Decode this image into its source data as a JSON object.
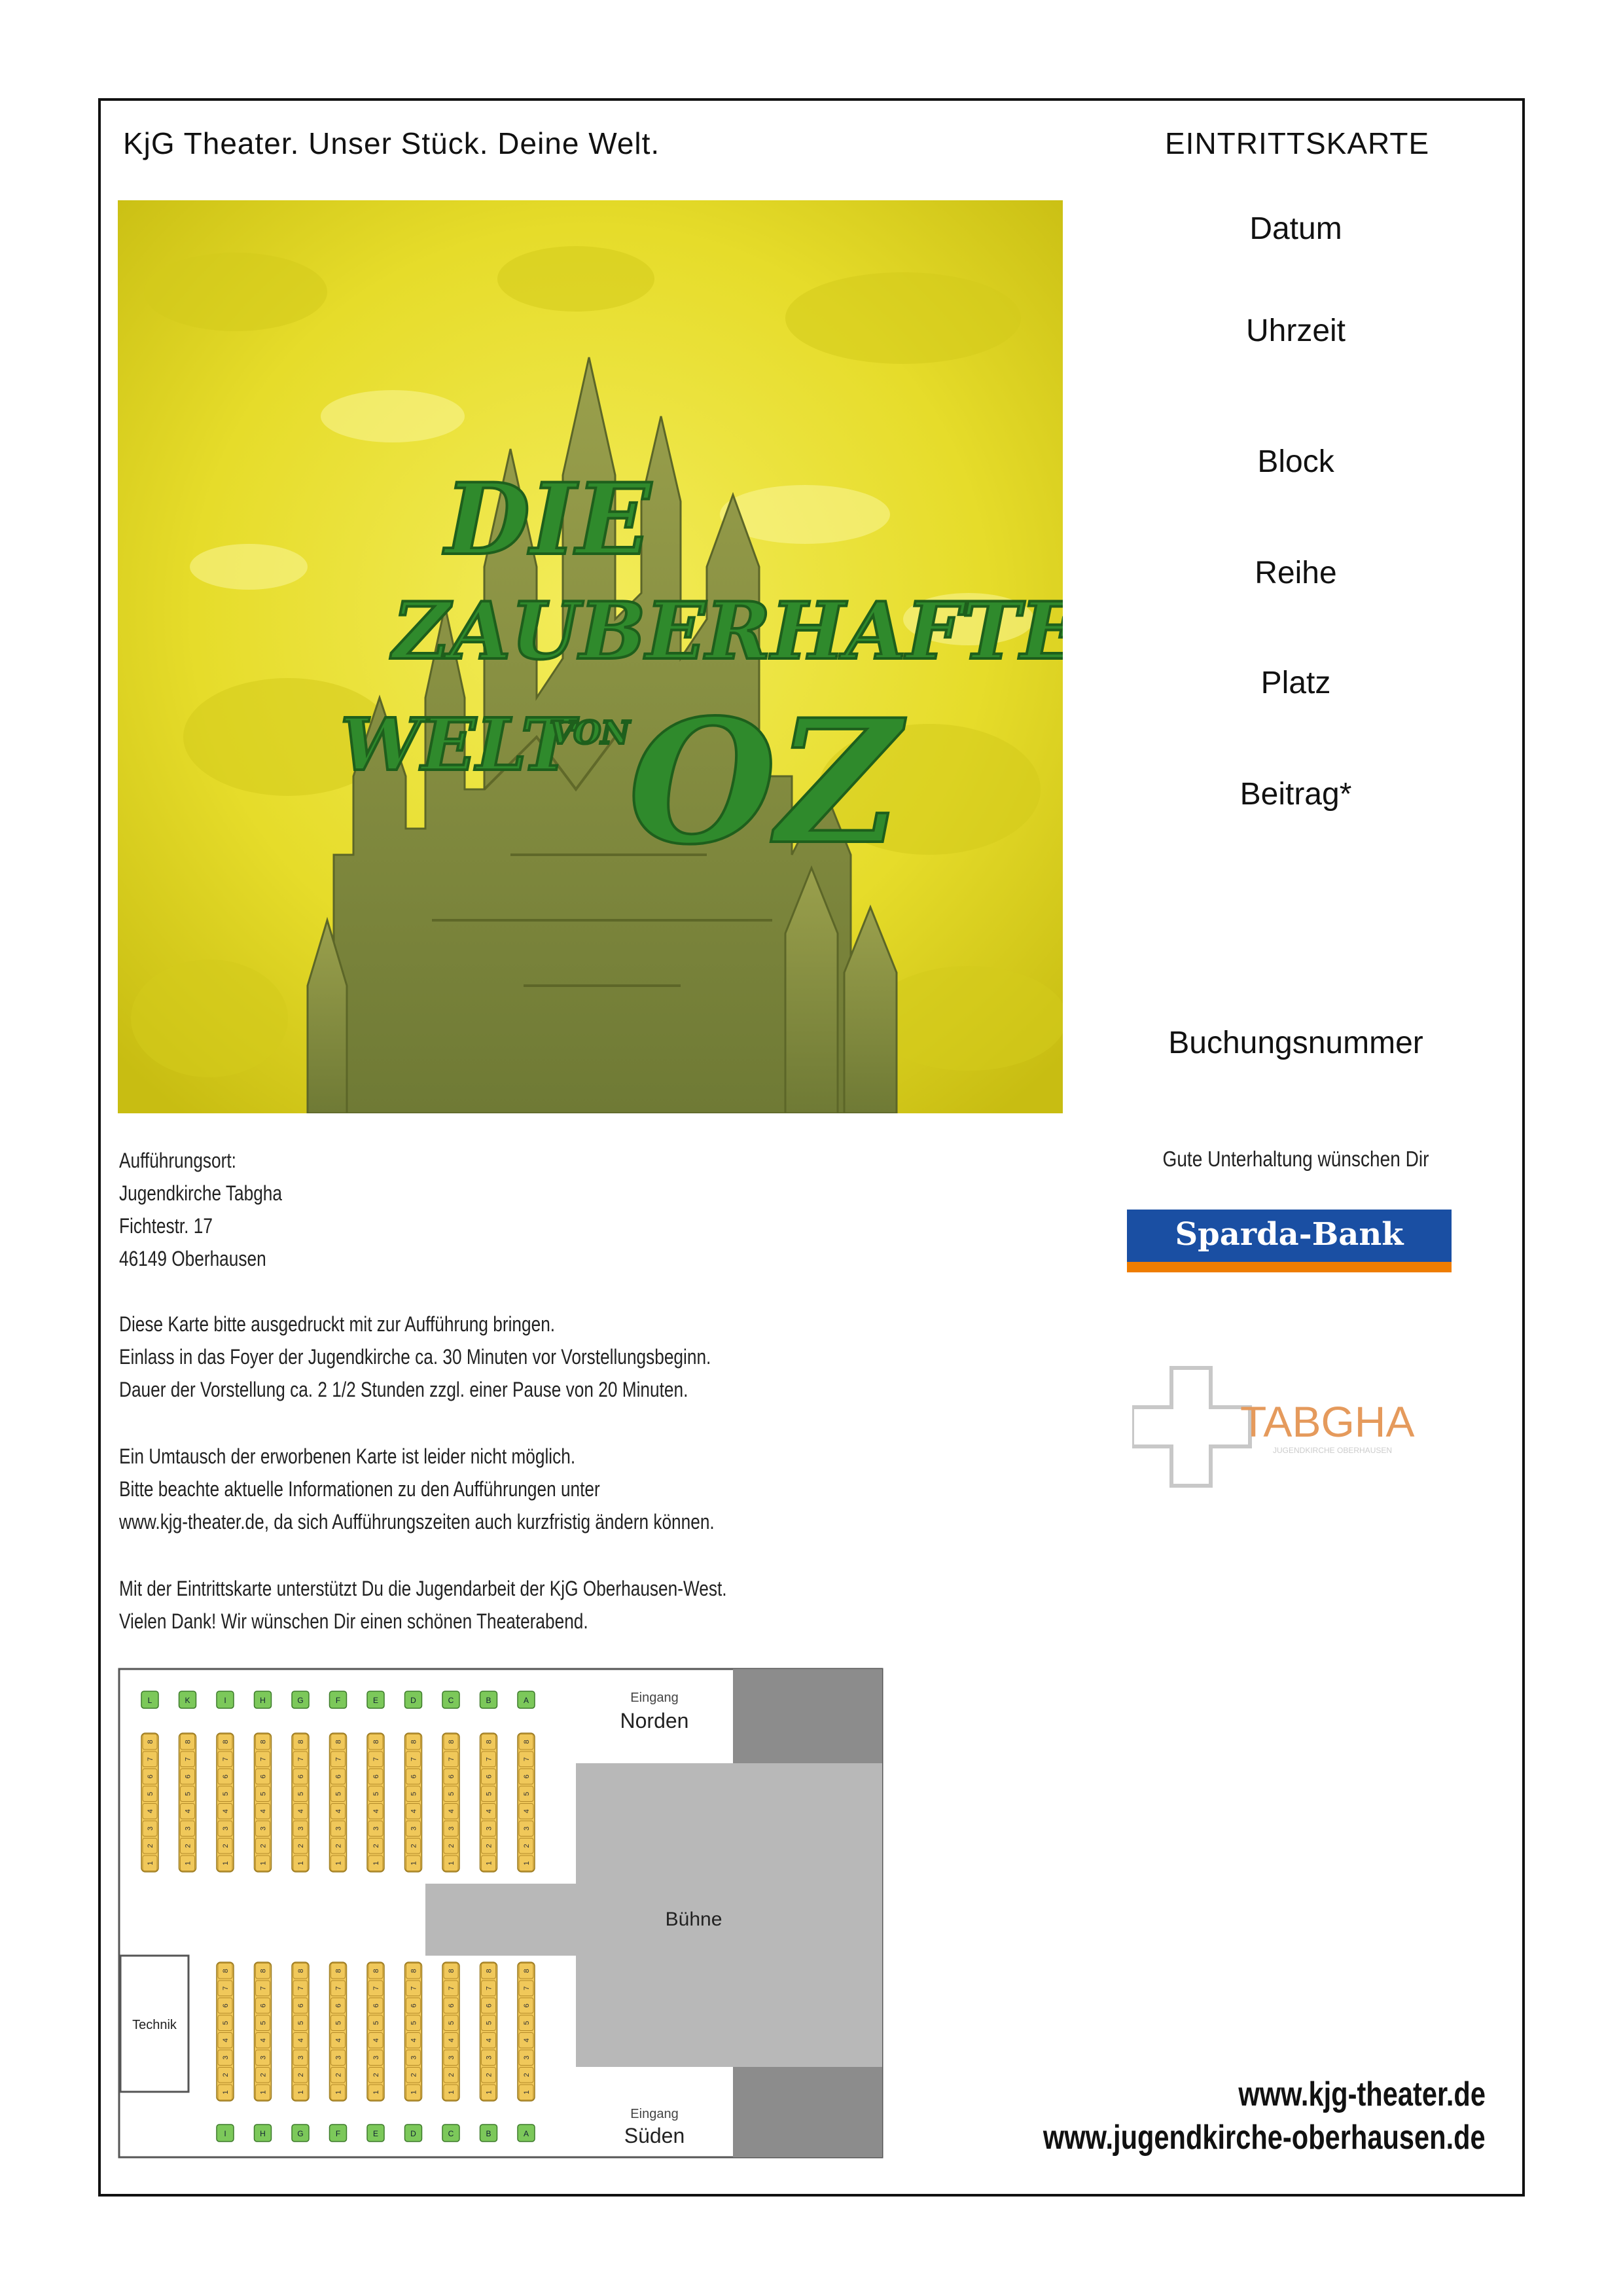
{
  "header": {
    "slogan": "KjG Theater. Unser Stück. Deine Welt.",
    "ticket_title": "EINTRITTSKARTE"
  },
  "ticket_fields": {
    "date": "Datum",
    "time": "Uhrzeit",
    "block": "Block",
    "row": "Reihe",
    "seat": "Platz",
    "fee": "Beitrag*",
    "booking": "Buchungsnummer"
  },
  "poster": {
    "title_line1": "DIE",
    "title_line2": "ZAUBERHAFTE",
    "title_line3": "WELT",
    "title_small": "VON",
    "title_oz": "OZ"
  },
  "venue": {
    "label": "Aufführungsort:",
    "name": "Jugendkirche Tabgha",
    "street": "Fichtestr. 17",
    "city": "46149 Oberhausen"
  },
  "notes": {
    "p1_l1": "Diese Karte bitte ausgedruckt mit zur Aufführung bringen.",
    "p1_l2": "Einlass in das Foyer der Jugendkirche ca. 30 Minuten vor Vorstellungsbeginn.",
    "p1_l3": "Dauer der Vorstellung ca. 2 1/2 Stunden zzgl. einer Pause von 20 Minuten.",
    "p2_l1": "Ein Umtausch der erworbenen Karte ist leider nicht möglich.",
    "p2_l2": "Bitte beachte aktuelle Informationen zu den Aufführungen unter",
    "p2_l3": "www.kjg-theater.de, da sich Aufführungszeiten auch kurzfristig ändern können.",
    "p3_l1": "Mit der Eintrittskarte unterstützt Du die Jugendarbeit der KjG Oberhausen-West.",
    "p3_l2": "Vielen Dank! Wir wünschen Dir einen schönen Theaterabend."
  },
  "sponsors": {
    "thanks": "Gute Unterhaltung wünschen Dir",
    "bank": "Sparda-Bank",
    "church": "TABGHA",
    "church_sub": "JUGENDKIRCHE OBERHAUSEN"
  },
  "footer": {
    "url1": "www.kjg-theater.de",
    "url2": "www.jugendkirche-oberhausen.de"
  },
  "seating_plan": {
    "north_small": "Eingang",
    "north": "Norden",
    "south_small": "Eingang",
    "south": "Süden",
    "stage": "Bühne",
    "tech": "Technik",
    "blocks_north": [
      "L",
      "K",
      "I",
      "H",
      "G",
      "F",
      "E",
      "D",
      "C",
      "B",
      "A"
    ],
    "blocks_south": [
      "I",
      "H",
      "G",
      "F",
      "E",
      "D",
      "C",
      "B",
      "A"
    ],
    "seat_numbers": [
      "1",
      "2",
      "3",
      "4",
      "5",
      "6",
      "7",
      "8"
    ],
    "colors": {
      "seat": "#f0c85a",
      "block": "#7cc85a",
      "stage": "#b5b5b5",
      "entrance": "#8a8a8a"
    }
  }
}
